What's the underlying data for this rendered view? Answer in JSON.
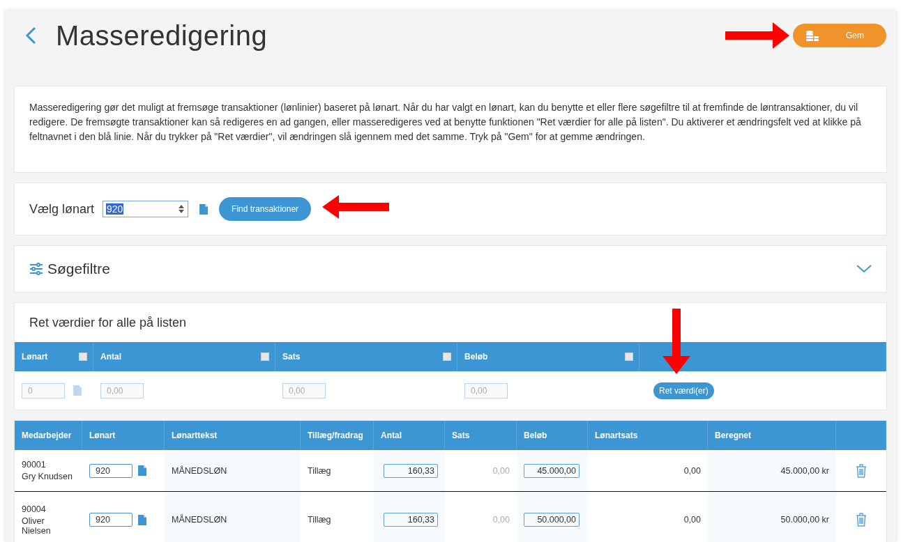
{
  "header": {
    "title": "Masseredigering",
    "save_button": "Gem"
  },
  "info": {
    "text": "Masseredigering gør det muligt at fremsøge transaktioner (lønlinier) baseret på lønart. Når du har valgt en lønart, kan du benytte et eller flere søgefiltre til at fremfinde de løntransaktioner, du vil redigere. De fremsøgte transaktioner kan så redigeres en ad gangen, eller masseredigeres ved at benytte funktionen \"Ret værdier for alle på listen\". Du aktiverer et ændringsfelt ved at klikke på feltnavnet i den blå linie. Når du trykker på \"Ret værdier\", vil ændringen slå igennem med det samme. Tryk på \"Gem\" for at gemme ændringen."
  },
  "select": {
    "label": "Vælg lønart",
    "value": "920",
    "button": "Find transaktioner"
  },
  "filters": {
    "title": "Søgefiltre",
    "expanded": false
  },
  "bulk_edit": {
    "title": "Ret værdier for alle på listen",
    "button": "Ret værdi(er)",
    "fields": [
      {
        "label": "Lønart",
        "checked": false,
        "placeholder": "0",
        "has_lookup": true
      },
      {
        "label": "Antal",
        "checked": false,
        "placeholder": "0,00",
        "has_lookup": false
      },
      {
        "label": "Sats",
        "checked": false,
        "placeholder": "0,00",
        "has_lookup": false
      },
      {
        "label": "Beløb",
        "checked": false,
        "placeholder": "0,00",
        "has_lookup": false
      }
    ]
  },
  "table": {
    "columns": [
      "Medarbejder",
      "Lønart",
      "Lønarttekst",
      "Tillæg/fradrag",
      "Antal",
      "Sats",
      "Beløb",
      "Lønartsats",
      "Beregnet"
    ],
    "rows": [
      {
        "employee_id": "90001",
        "employee_name": "Gry Knudsen",
        "wage_type": "920",
        "wage_text": "MÅNEDSLØN",
        "type": "Tillæg",
        "quantity": "160,33",
        "rate": "0,00",
        "amount": "45.000,00",
        "wage_rate": "0,00",
        "calculated": "45.000,00 kr"
      },
      {
        "employee_id": "90004",
        "employee_name": "Oliver Nielsen",
        "wage_type": "920",
        "wage_text": "MÅNEDSLØN",
        "type": "Tillæg",
        "quantity": "160,33",
        "rate": "0,00",
        "amount": "50.000,00",
        "wage_rate": "0,00",
        "calculated": "50.000,00 kr"
      }
    ]
  }
}
